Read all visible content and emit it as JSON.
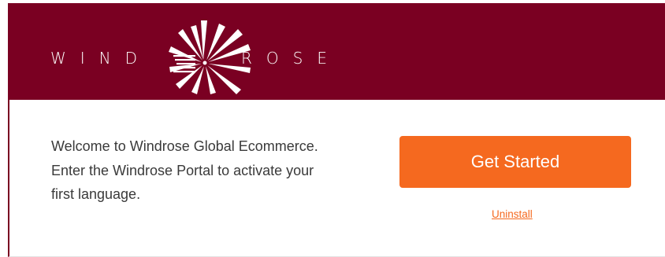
{
  "brand": {
    "name_left": "WIND",
    "name_right": "ROSE",
    "logo_icon": "windrose-burst-icon",
    "colors": {
      "banner_bg": "#7a0022",
      "logo_fg": "#ffffff"
    }
  },
  "welcome": {
    "line1": "Welcome to Windrose Global Ecommerce.",
    "line2": "Enter the Windrose Portal to activate your",
    "line3": "first language."
  },
  "actions": {
    "get_started_label": "Get Started",
    "uninstall_label": "Uninstall",
    "accent_color": "#f5691f"
  }
}
